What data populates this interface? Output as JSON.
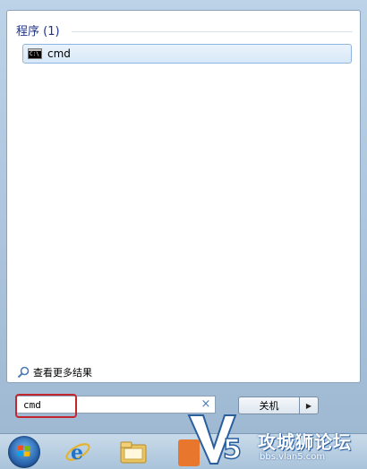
{
  "results": {
    "section_header": "程序 (1)",
    "items": [
      {
        "label": "cmd",
        "icon": "cmd-icon"
      }
    ],
    "more_results_label": "查看更多结果"
  },
  "search": {
    "value": "cmd",
    "clear_symbol": "×"
  },
  "shutdown": {
    "label": "关机",
    "arrow": "▶"
  },
  "watermark": {
    "title": "攻城狮论坛",
    "url": "bbs.vlan5.com",
    "logo": "V5"
  },
  "colors": {
    "header": "#1e3287",
    "highlight_box": "#c1272d",
    "selection": "#d8e8f8",
    "taskbar": "#a9c3da"
  }
}
